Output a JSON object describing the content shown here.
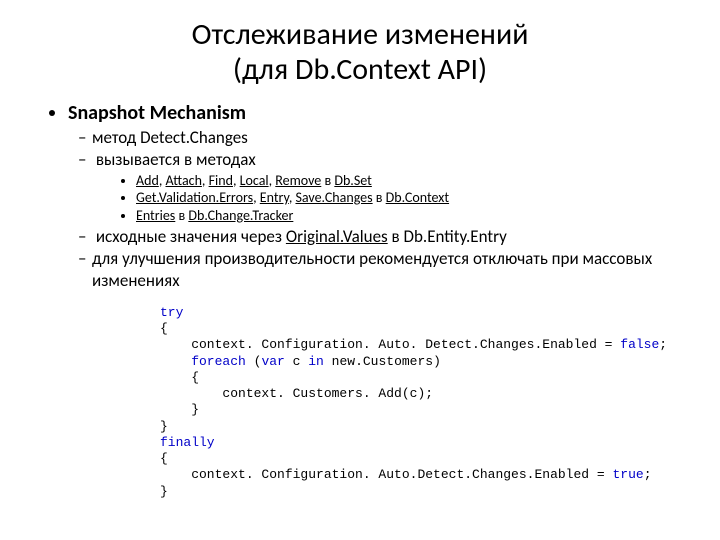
{
  "title_line1": "Отслеживание изменений",
  "title_line2": "(для Db.Context API)",
  "bullet1": "Snapshot Mechanism",
  "sub": {
    "s1": "метод Detect.Changes",
    "s2": "вызывается в методах",
    "s3_pre": "исходные значения через ",
    "s3_link": "Original.Values",
    "s3_post": " в Db.Entity.Entry",
    "s4": "для улучшения производительности рекомендуется отключать при массовых изменениях"
  },
  "lvl3": {
    "a": {
      "p0": "Add",
      "p1": "Attach",
      "p2": "Find",
      "p3": "Local",
      "p4": "Remove",
      "mid": " в ",
      "tail": "Db.Set"
    },
    "b": {
      "p0": "Get.Validation.Errors",
      "p1": "Entry",
      "p2": "Save.Changes",
      "mid": " в ",
      "tail": "Db.Context"
    },
    "c": {
      "p0": "Entries",
      "mid": " в ",
      "tail": "Db.Change.Tracker"
    }
  },
  "code": {
    "l0_kw": "try",
    "l1": "{",
    "l2a": "    context. Configuration. Auto. Detect.Changes.Enabled = ",
    "l2b_kw": "false",
    "l2c": ";",
    "l3a_kw": "    foreach",
    "l3b": " (",
    "l3c_kw": "var",
    "l3d": " c ",
    "l3e_kw": "in",
    "l3f": " new.Customers)",
    "l4": "    {",
    "l5": "        context. Customers. Add(c);",
    "l6": "    }",
    "l7": "}",
    "l8_kw": "finally",
    "l9": "{",
    "l10a": "    context. Configuration. Auto.Detect.Changes.Enabled = ",
    "l10b_kw": "true",
    "l10c": ";",
    "l11": "}"
  }
}
